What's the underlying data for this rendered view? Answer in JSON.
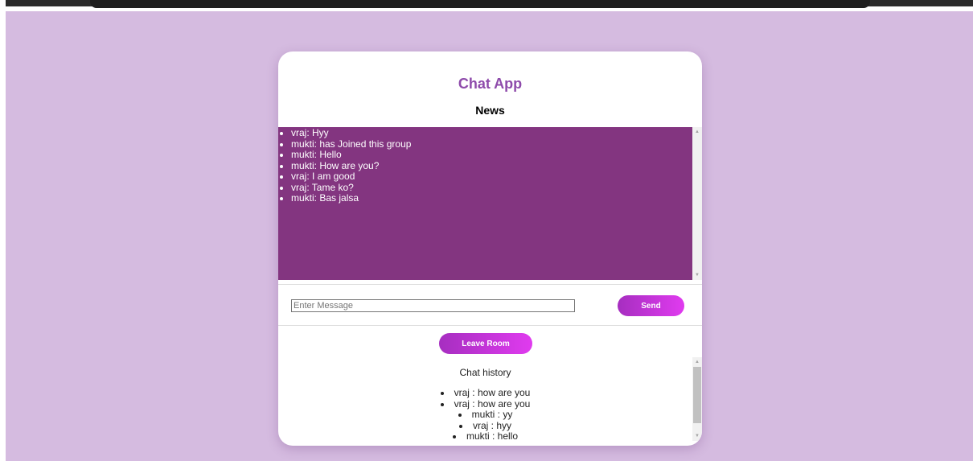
{
  "app": {
    "title": "Chat App",
    "section_title": "News"
  },
  "messages": [
    "vraj: Hyy",
    "mukti: has Joined this group",
    "mukti: Hello",
    "mukti: How are you?",
    "vraj: I am good",
    "vraj: Tame ko?",
    "mukti: Bas jalsa"
  ],
  "composer": {
    "placeholder": "Enter Message",
    "value": "",
    "send_label": "Send"
  },
  "leave_label": "Leave Room",
  "history": {
    "title": "Chat history",
    "items": [
      "vraj : how are you",
      "vraj : how are you",
      "mukti : yy",
      "vraj : hyy",
      "mukti : hello"
    ]
  },
  "colors": {
    "background": "#d5bbe0",
    "accent": "#8e4bab",
    "message_panel": "#833580",
    "button_gradient_start": "#a62ec0",
    "button_gradient_end": "#e03bef"
  }
}
